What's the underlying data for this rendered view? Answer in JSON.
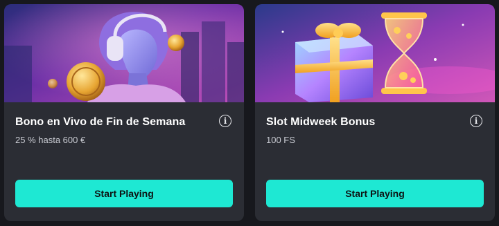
{
  "cards": [
    {
      "title": "Bono en Vivo de Fin de Semana",
      "subtitle": "25 % hasta 600 €",
      "button_label": "Start Playing",
      "banner_icon": "goddess-with-headphones-and-coins-illustration",
      "info_icon": "info-icon"
    },
    {
      "title": "Slot Midweek Bonus",
      "subtitle": "100 FS",
      "button_label": "Start Playing",
      "banner_icon": "gift-box-and-hourglass-illustration",
      "info_icon": "info-icon"
    }
  ],
  "colors": {
    "page_bg": "#17181d",
    "card_bg": "#2b2d34",
    "accent": "#1ee8d3",
    "button_text": "#0d1414"
  }
}
